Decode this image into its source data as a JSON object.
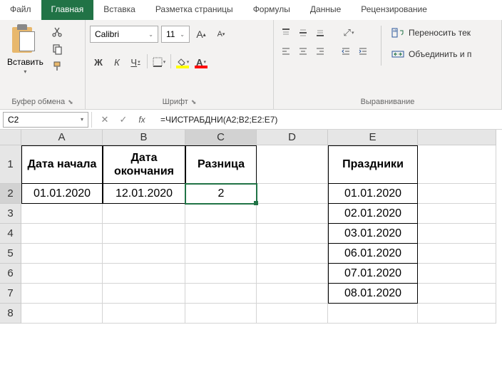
{
  "tabs": {
    "file": "Файл",
    "home": "Главная",
    "insert": "Вставка",
    "pagelayout": "Разметка страницы",
    "formulas": "Формулы",
    "data": "Данные",
    "review": "Рецензирование"
  },
  "ribbon": {
    "clipboard": {
      "paste": "Вставить",
      "label": "Буфер обмена"
    },
    "font": {
      "name": "Calibri",
      "size": "11",
      "bold": "Ж",
      "italic": "К",
      "underline": "Ч",
      "label": "Шрифт"
    },
    "alignment": {
      "wrap": "Переносить тек",
      "merge": "Объединить и п",
      "label": "Выравнивание"
    }
  },
  "formula_bar": {
    "cell_ref": "C2",
    "formula": "=ЧИСТРАБДНИ(A2;B2;E2:E7)"
  },
  "columns": [
    "A",
    "B",
    "C",
    "D",
    "E"
  ],
  "sheet": {
    "headers": {
      "A1": "Дата начала",
      "B1": "Дата окончания",
      "C1": "Разница",
      "E1": "Праздники"
    },
    "A2": "01.01.2020",
    "B2": "12.01.2020",
    "C2": "2",
    "E2": "01.01.2020",
    "E3": "02.01.2020",
    "E4": "03.01.2020",
    "E5": "06.01.2020",
    "E6": "07.01.2020",
    "E7": "08.01.2020"
  }
}
